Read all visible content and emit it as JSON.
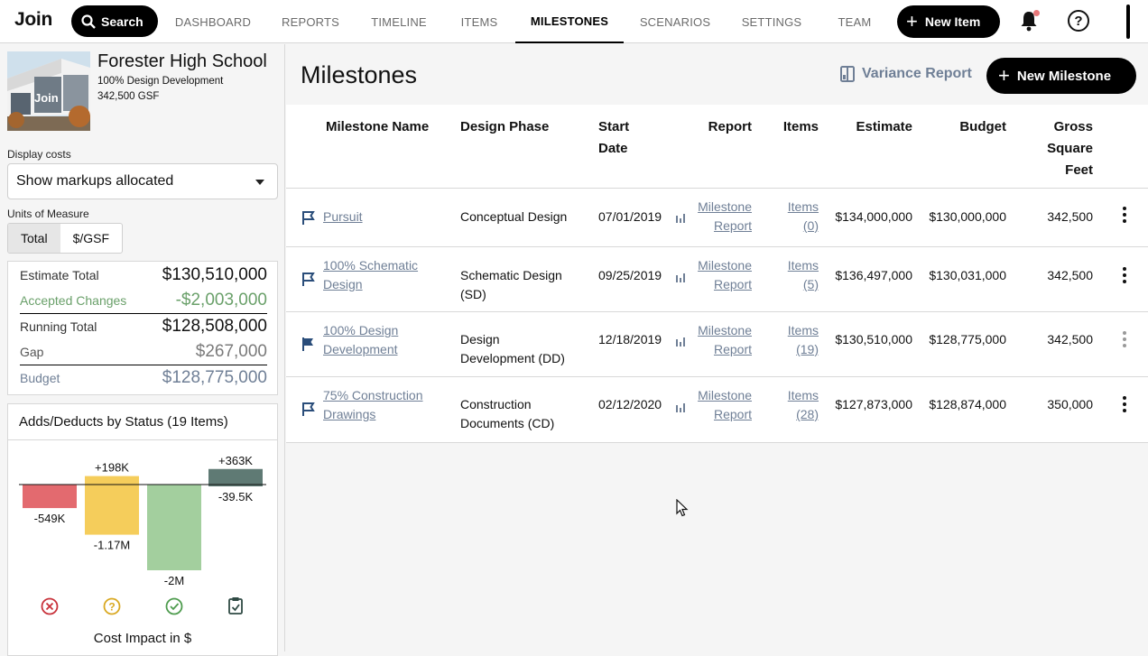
{
  "app": {
    "logo": "Join"
  },
  "nav": {
    "search_label": "Search",
    "tabs": [
      "DASHBOARD",
      "REPORTS",
      "TIMELINE",
      "ITEMS",
      "MILESTONES",
      "SCENARIOS",
      "SETTINGS",
      "TEAM"
    ],
    "active_tab": "MILESTONES",
    "new_item_label": "New Item"
  },
  "project": {
    "thumb_text": "Join",
    "name": "Forester High School",
    "milestone": "100% Design Development",
    "gsf": "342,500 GSF"
  },
  "sidebar": {
    "display_costs_label": "Display costs",
    "display_costs_value": "Show markups allocated",
    "units_label": "Units of Measure",
    "units": [
      "Total",
      "$/GSF"
    ],
    "units_selected": "Total",
    "costs": [
      {
        "label": "Estimate Total",
        "value": "$130,510,000",
        "color": "#111111"
      },
      {
        "label": "Accepted Changes",
        "value": "-$2,003,000",
        "color": "#6aa06a"
      },
      {
        "label": "Running Total",
        "value": "$128,508,000",
        "color": "#111111"
      },
      {
        "label": "Gap",
        "value": "$267,000",
        "color": "#7a7a7a"
      },
      {
        "label": "Budget",
        "value": "$128,775,000",
        "color": "#6f7f96"
      }
    ]
  },
  "status_chart": {
    "title": "Adds/Deducts by Status (19 Items)",
    "footer": "Cost Impact in $",
    "chart_data": {
      "type": "bar",
      "categories": [
        "Rejected",
        "Pending",
        "Accepted",
        "Incorporated"
      ],
      "series": [
        {
          "values": [
            0,
            198,
            0,
            363
          ],
          "labels": [
            "",
            "+198K",
            "",
            "+363K"
          ]
        },
        {
          "values": [
            -549,
            -1170,
            -2000,
            -39.5
          ],
          "labels": [
            "-549K",
            "-1.17M",
            "-2M",
            "-39.5K"
          ]
        }
      ],
      "colors": [
        "#e36a6f",
        "#f5cd5b",
        "#a3cf9e",
        "#5f7a74"
      ],
      "icons": [
        "x-circle-icon",
        "question-circle-icon",
        "check-circle-icon",
        "clipboard-check-icon"
      ],
      "icon_colors": [
        "#c8313a",
        "#d9a821",
        "#4d9b4d",
        "#2f4a44"
      ]
    }
  },
  "main": {
    "title": "Milestones",
    "variance_label": "Variance Report",
    "new_milestone_label": "New Milestone",
    "columns": {
      "name": "Milestone Name",
      "phase": "Design Phase",
      "start": [
        "Start",
        "Date"
      ],
      "report": "Report",
      "items": "Items",
      "estimate": "Estimate",
      "budget": "Budget",
      "gsf": [
        "Gross",
        "Square",
        "Feet"
      ]
    },
    "rows": [
      {
        "name": [
          "Pursuit"
        ],
        "phase": [
          "Conceptual Design"
        ],
        "start": "07/01/2019",
        "report": [
          "Milestone",
          "Report"
        ],
        "items": [
          "Items",
          "(0)"
        ],
        "estimate": "$134,000,000",
        "budget": "$130,000,000",
        "gsf": "342,500",
        "active": false
      },
      {
        "name": [
          "100% Schematic",
          "Design"
        ],
        "phase": [
          "Schematic Design",
          "(SD)"
        ],
        "start": "09/25/2019",
        "report": [
          "Milestone",
          "Report"
        ],
        "items": [
          "Items",
          "(5)"
        ],
        "estimate": "$136,497,000",
        "budget": "$130,031,000",
        "gsf": "342,500",
        "active": false
      },
      {
        "name": [
          "100% Design",
          "Development"
        ],
        "phase": [
          "Design",
          "Development (DD)"
        ],
        "start": "12/18/2019",
        "report": [
          "Milestone",
          "Report"
        ],
        "items": [
          "Items",
          "(19)"
        ],
        "estimate": "$130,510,000",
        "budget": "$128,775,000",
        "gsf": "342,500",
        "active": true
      },
      {
        "name": [
          "75% Construction",
          "Drawings"
        ],
        "phase": [
          "Construction",
          "Documents (CD)"
        ],
        "start": "02/12/2020",
        "report": [
          "Milestone",
          "Report"
        ],
        "items": [
          "Items",
          "(28)"
        ],
        "estimate": "$127,873,000",
        "budget": "$128,874,000",
        "gsf": "350,000",
        "active": false
      }
    ]
  }
}
